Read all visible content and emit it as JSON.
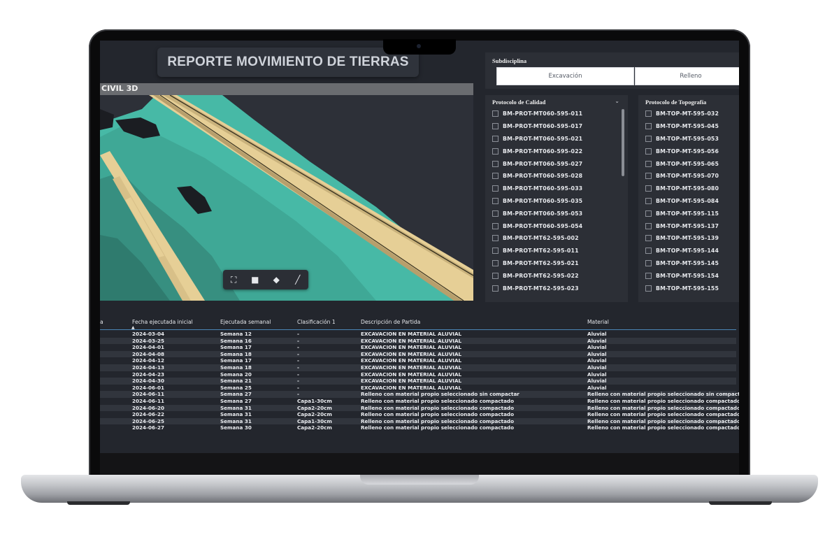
{
  "report": {
    "title": "REPORTE MOVIMIENTO DE TIERRAS",
    "viewer_label": "CIVIL 3D"
  },
  "colors": {
    "terrain": "#4fc3b0",
    "road": "#e6cf96",
    "background": "#23262d"
  },
  "viewer_toolbar": [
    {
      "icon": "fullscreen-icon",
      "glyph": "⛶"
    },
    {
      "icon": "camera-icon",
      "glyph": "■"
    },
    {
      "icon": "cube-icon",
      "glyph": "◆"
    },
    {
      "icon": "brush-icon",
      "glyph": "╱"
    }
  ],
  "subdisciplina": {
    "title": "Subdisciplina",
    "options": [
      "Excavación",
      "Relleno"
    ]
  },
  "protocolo_calidad": {
    "title": "Protocolo de Calidad",
    "items": [
      "BM-PROT-MT060-595-011",
      "BM-PROT-MT060-595-017",
      "BM-PROT-MT060-595-021",
      "BM-PROT-MT060-595-022",
      "BM-PROT-MT060-595-027",
      "BM-PROT-MT060-595-028",
      "BM-PROT-MT060-595-033",
      "BM-PROT-MT060-595-035",
      "BM-PROT-MT060-595-053",
      "BM-PROT-MT060-595-054",
      "BM-PROT-MT62-595-002",
      "BM-PROT-MT62-595-011",
      "BM-PROT-MT62-595-021",
      "BM-PROT-MT62-595-022",
      "BM-PROT-MT62-595-023"
    ]
  },
  "protocolo_topografia": {
    "title": "Protocolo de Topografía",
    "items": [
      "BM-TOP-MT-595-032",
      "BM-TOP-MT-595-045",
      "BM-TOP-MT-595-053",
      "BM-TOP-MT-595-056",
      "BM-TOP-MT-595-065",
      "BM-TOP-MT-595-070",
      "BM-TOP-MT-595-080",
      "BM-TOP-MT-595-084",
      "BM-TOP-MT-595-115",
      "BM-TOP-MT-595-137",
      "BM-TOP-MT-595-139",
      "BM-TOP-MT-595-144",
      "BM-TOP-MT-595-145",
      "BM-TOP-MT-595-154",
      "BM-TOP-MT-595-155"
    ]
  },
  "table": {
    "columns": [
      "a",
      "Fecha ejecutada inicial",
      "Ejecutada semanal",
      "Clasificación 1",
      "Descripción de Partida",
      "Material"
    ],
    "rows": [
      [
        "",
        "2024-03-04",
        "Semana 12",
        "-",
        "EXCAVACION EN MATERIAL ALUVIAL",
        "Aluvial"
      ],
      [
        "",
        "2024-03-25",
        "Semana 16",
        "-",
        "EXCAVACION EN MATERIAL ALUVIAL",
        "Aluvial"
      ],
      [
        "",
        "2024-04-01",
        "Semana 17",
        "-",
        "EXCAVACION EN MATERIAL ALUVIAL",
        "Aluvial"
      ],
      [
        "",
        "2024-04-08",
        "Semana 18",
        "-",
        "EXCAVACION EN MATERIAL ALUVIAL",
        "Aluvial"
      ],
      [
        "",
        "2024-04-12",
        "Semana 17",
        "-",
        "EXCAVACION EN MATERIAL ALUVIAL",
        "Aluvial"
      ],
      [
        "",
        "2024-04-13",
        "Semana 18",
        "-",
        "EXCAVACION EN MATERIAL ALUVIAL",
        "Aluvial"
      ],
      [
        "",
        "2024-04-23",
        "Semana 20",
        "-",
        "EXCAVACION EN MATERIAL ALUVIAL",
        "Aluvial"
      ],
      [
        "",
        "2024-04-30",
        "Semana 21",
        "-",
        "EXCAVACION EN MATERIAL ALUVIAL",
        "Aluvial"
      ],
      [
        "",
        "2024-06-01",
        "Semana 25",
        "-",
        "EXCAVACION EN MATERIAL ALUVIAL",
        "Aluvial"
      ],
      [
        "",
        "2024-06-11",
        "Semana 27",
        "-",
        "Relleno con material propio seleccionado sin compactar",
        "Relleno con material propio seleccionado sin compactar"
      ],
      [
        "",
        "2024-06-11",
        "Semana 27",
        "Capa1-30cm",
        "Relleno con material propio seleccionado compactado",
        "Relleno con material propio seleccionado compactado"
      ],
      [
        "",
        "2024-06-20",
        "Semana 31",
        "Capa2-20cm",
        "Relleno con material propio seleccionado compactado",
        "Relleno con material propio seleccionado compactado"
      ],
      [
        "",
        "2024-06-22",
        "Semana 31",
        "Capa2-20cm",
        "Relleno con material propio seleccionado compactado",
        "Relleno con material propio seleccionado compactado"
      ],
      [
        "",
        "2024-06-25",
        "Semana 31",
        "Capa1-30cm",
        "Relleno con material propio seleccionado compactado",
        "Relleno con material propio seleccionado compactado"
      ],
      [
        "",
        "2024-06-27",
        "Semana 30",
        "Capa2-20cm",
        "Relleno con material propio seleccionado compactado",
        "Relleno con material propio seleccionado compactado"
      ]
    ]
  }
}
